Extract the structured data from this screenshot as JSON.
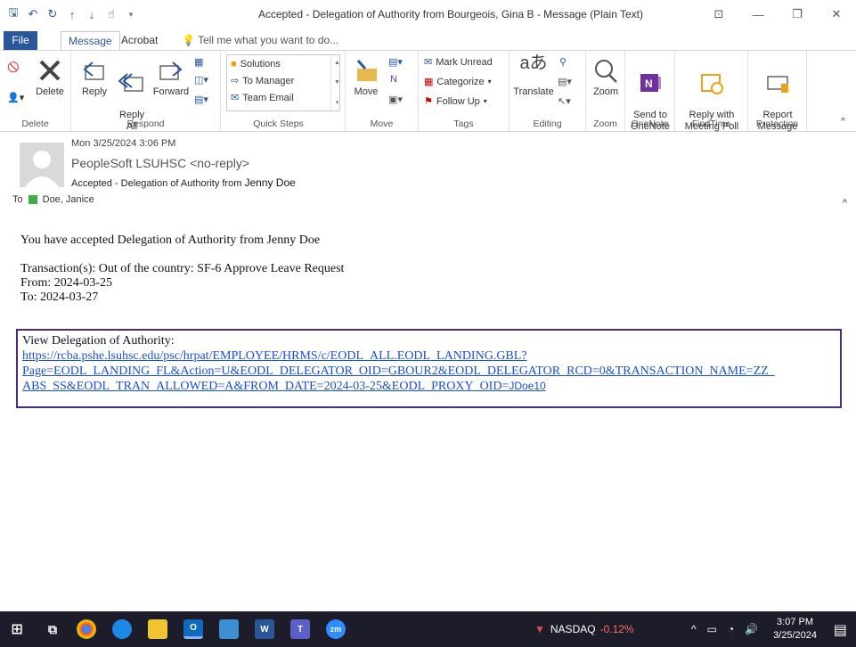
{
  "title_bar": {
    "title": "Accepted - Delegation of Authority from Bourgeois, Gina B  -  Message (Plain Text)"
  },
  "tabs": [
    "File",
    "Message",
    "Acrobat"
  ],
  "tell_me": "Tell me what you want to do...",
  "ribbon": {
    "delete_group": {
      "delete": "Delete",
      "label": "Delete"
    },
    "respond_group": {
      "reply": "Reply",
      "reply_all": "Reply\nAll",
      "forward": "Forward",
      "label": "Respond"
    },
    "quick_steps": {
      "items": [
        "Solutions",
        "To Manager",
        "Team Email"
      ],
      "label": "Quick Steps"
    },
    "move_group": {
      "move": "Move",
      "label": "Move"
    },
    "tags_group": {
      "mark_unread": "Mark Unread",
      "categorize": "Categorize",
      "follow_up": "Follow Up",
      "label": "Tags"
    },
    "editing_group": {
      "translate": "Translate",
      "label": "Editing"
    },
    "zoom_group": {
      "zoom": "Zoom",
      "label": "Zoom"
    },
    "onenote_group": {
      "send": "Send to\nOneNote",
      "label": "OneNote"
    },
    "findtime_group": {
      "reply_poll": "Reply with\nMeeting Poll",
      "label": "FindTime"
    },
    "protection_group": {
      "report": "Report\nMessage",
      "label": "Protection"
    }
  },
  "message": {
    "date": "Mon 3/25/2024 3:06 PM",
    "sender": "PeopleSoft LSUHSC <no-reply>",
    "subject_prefix": "Accepted - Delegation of Authority from",
    "subject_name": "Jenny Doe",
    "to_label": "To",
    "to_name": "Doe, Janice",
    "body": {
      "line1": "You have accepted Delegation of Authority from  Jenny Doe",
      "line2": "Transaction(s): Out of the country: SF-6 Approve Leave Request",
      "line3": "From: 2024-03-25",
      "line4": "To: 2024-03-27",
      "view_label": "View Delegation of Authority:",
      "link_line1": "https://rcba.pshe.lsuhsc.edu/psc/hrpat/EMPLOYEE/HRMS/c/EODL_ALL.EODL_LANDING.GBL?",
      "link_line2": "Page=EODL_LANDING_FL&Action=U&EODL_DELEGATOR_OID=GBOUR2&EODL_DELEGATOR_RCD=0&TRANSACTION_NAME=ZZ_",
      "link_line3": "ABS_SS&EODL_TRAN_ALLOWED=A&FROM_DATE=2024-03-25&EODL_PROXY_OID=",
      "link_line3_end": "JDoe10"
    }
  },
  "taskbar": {
    "nasdaq_label": "NASDAQ",
    "nasdaq_change": "-0.12%",
    "time": "3:07 PM",
    "date": "3/25/2024"
  }
}
